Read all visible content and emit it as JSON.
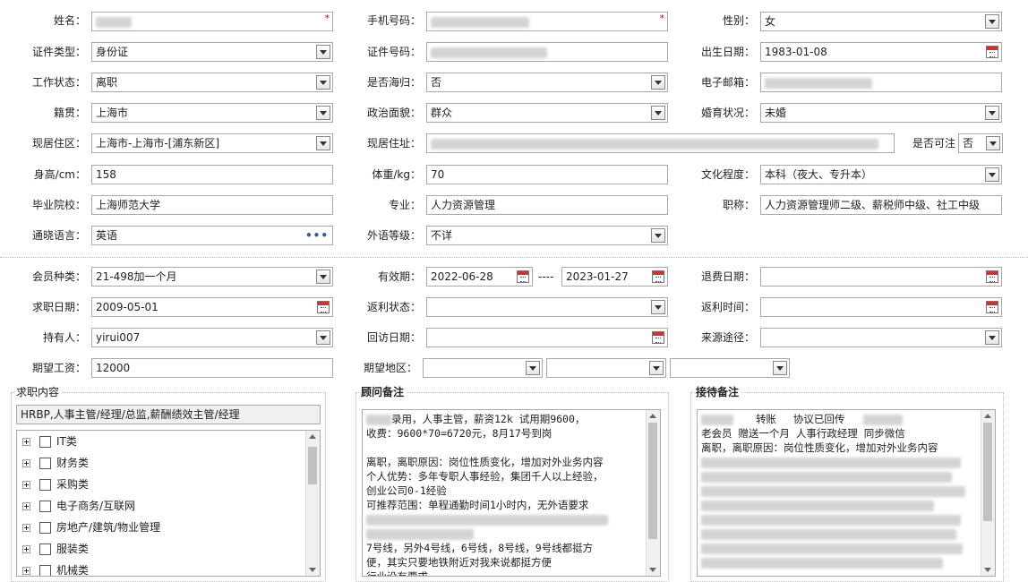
{
  "row1": {
    "name_label": "姓名：",
    "phone_label": "手机号码：",
    "gender_label": "性别：",
    "gender_value": "女"
  },
  "row2": {
    "idtype_label": "证件类型：",
    "idtype_value": "身份证",
    "idno_label": "证件号码：",
    "birth_label": "出生日期：",
    "birth_value": "1983-01-08"
  },
  "row3": {
    "workstatus_label": "工作状态：",
    "workstatus_value": "离职",
    "returnee_label": "是否海归：",
    "returnee_value": "否",
    "email_label": "电子邮箱："
  },
  "row4": {
    "origin_label": "籍贯：",
    "origin_value": "上海市",
    "political_label": "政治面貌：",
    "political_value": "群众",
    "marital_label": "婚育状况：",
    "marital_value": "未婚"
  },
  "row5": {
    "residence_label": "现居住区：",
    "residence_value": "上海市-上海市-[浦东新区]",
    "address_label": "现居住址：",
    "visible_label": "是否可注",
    "visible_value": "否"
  },
  "row6": {
    "height_label": "身高/cm：",
    "height_value": "158",
    "weight_label": "体重/kg：",
    "weight_value": "70",
    "education_label": "文化程度：",
    "education_value": "本科（夜大、专升本）"
  },
  "row7": {
    "school_label": "毕业院校：",
    "school_value": "上海师范大学",
    "major_label": "专业：",
    "major_value": "人力资源管理",
    "title_label": "职称：",
    "title_value": "人力资源管理师二级、薪税师中级、社工中级"
  },
  "row8": {
    "language_label": "通晓语言：",
    "language_value": "英语",
    "language_level_label": "外语等级：",
    "language_level_value": "不详"
  },
  "row9": {
    "member_label": "会员种类：",
    "member_value": "21-498加一个月",
    "valid_label": "有效期：",
    "valid_from": "2022-06-28",
    "valid_sep": "----",
    "valid_to": "2023-01-27",
    "refund_date_label": "退费日期："
  },
  "row10": {
    "jobdate_label": "求职日期：",
    "jobdate_value": "2009-05-01",
    "rebate_status_label": "返利状态：",
    "rebate_time_label": "返利时间："
  },
  "row11": {
    "holder_label": "持有人：",
    "holder_value": "yirui007",
    "visit_label": "回访日期：",
    "source_label": "来源途径："
  },
  "row12": {
    "salary_label": "期望工资：",
    "salary_value": "12000",
    "region_label": "期望地区："
  },
  "job_panel": {
    "title": "求职内容",
    "summary": "HRBP,人事主管/经理/总监,薪酬绩效主管/经理",
    "tree": [
      "IT类",
      "财务类",
      "采购类",
      "电子商务/互联网",
      "房地产/建筑/物业管理",
      "服装类",
      "机械类"
    ]
  },
  "advisor_panel": {
    "title": "顾问备注",
    "lines": [
      "录用，人事主管，薪资12k 试用期9600，",
      "收费：9600*70=6720元，8月17号到岗",
      "",
      "离职，离职原因：岗位性质变化，增加对外业务内容",
      "个人优势：多年专职人事经验，集团千人以上经验，",
      "创业公司0-1经验",
      "可推荐范围：单程通勤时间1小时内，无外语要求",
      "",
      "",
      "7号线，另外4号线，6号线，8号线，9号线都挺方",
      "便，其实只要地铁附近对我来说都挺方便",
      "行业没有要求"
    ]
  },
  "reception_panel": {
    "title": "接待备注",
    "line1_a": "转账",
    "line1_b": "协议已回传",
    "line2": "老会员 赠送一个月    人事行政经理  同步微信",
    "line3": "离职，离职原因：岗位性质变化，增加对外业务内容"
  }
}
